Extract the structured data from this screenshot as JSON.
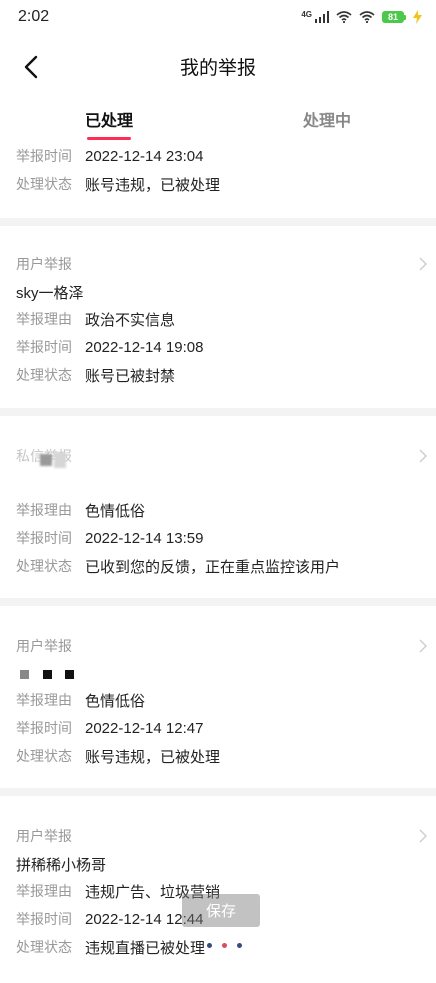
{
  "status_bar": {
    "time": "2:02",
    "network": "4G",
    "battery": "81"
  },
  "nav": {
    "title": "我的举报"
  },
  "tabs": [
    {
      "label": "已处理",
      "active": true
    },
    {
      "label": "处理中",
      "active": false
    }
  ],
  "labels": {
    "reason": "举报理由",
    "time": "举报时间",
    "status": "处理状态"
  },
  "reports": [
    {
      "time": "2022-12-14 23:04",
      "status": "账号违规，已被处理"
    },
    {
      "type": "用户举报",
      "user": "sky一格泽",
      "reason": "政治不实信息",
      "time": "2022-12-14 19:08",
      "status": "账号已被封禁"
    },
    {
      "type": "私信举报",
      "reason": "色情低俗",
      "time": "2022-12-14 13:59",
      "status": "已收到您的反馈，正在重点监控该用户"
    },
    {
      "type": "用户举报",
      "reason": "色情低俗",
      "time": "2022-12-14 12:47",
      "status": "账号违规，已被处理"
    },
    {
      "type": "用户举报",
      "user": "拼稀稀小杨哥",
      "reason": "违规广告、垃圾营销",
      "time": "2022-12-14 12:44",
      "status": "违规直播已被处理"
    }
  ],
  "overlay": {
    "save_label": "保存"
  },
  "colors": {
    "accent": "#ff2d55",
    "separator": "#f3f3f3",
    "label": "#999999",
    "text": "#222222"
  }
}
